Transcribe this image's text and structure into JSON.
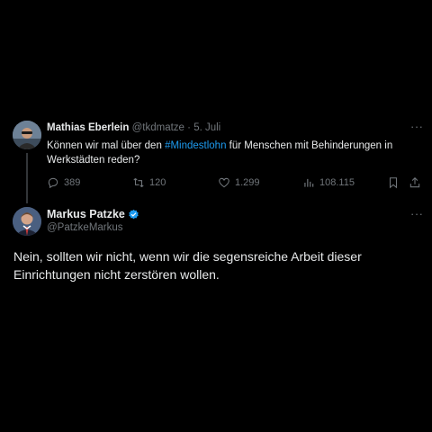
{
  "quoted_tweet": {
    "author_name": "Mathias Eberlein",
    "handle": "@tkdmatze",
    "separator": "·",
    "date": "5. Juli",
    "more_icon": "more-horizontal-icon",
    "text_before": "Können wir mal über den ",
    "hashtag": "#Mindestlohn",
    "text_after": " für Menschen mit Behinderungen in Werkstädten reden?",
    "actions": {
      "replies": "389",
      "retweets": "120",
      "likes": "1.299",
      "views": "108.115"
    }
  },
  "reply_tweet": {
    "author_name": "Markus Patzke",
    "handle": "@PatzkeMarkus",
    "verified_icon": "verified-badge-icon",
    "text": "Nein, sollten wir nicht, wenn wir die segensreiche Arbeit dieser Einrichtungen nicht zerstören wollen."
  },
  "colors": {
    "background": "#000000",
    "text": "#e7e9ea",
    "muted": "#71767b",
    "accent": "#1d9bf0"
  }
}
